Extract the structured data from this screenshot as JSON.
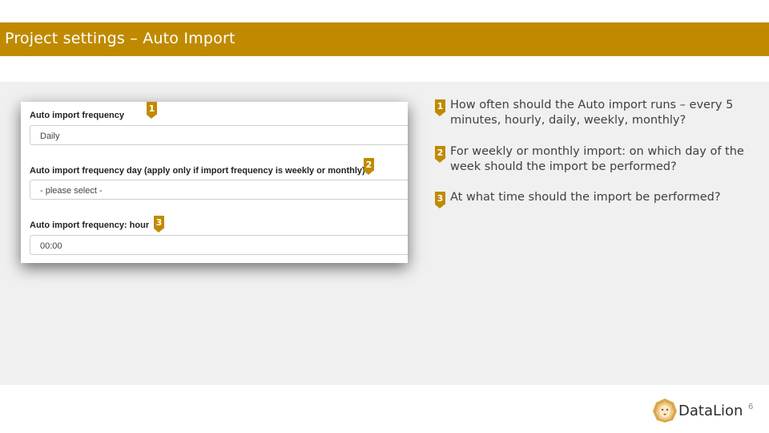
{
  "slide": {
    "title": "Project settings – Auto Import",
    "page_number": "6"
  },
  "form": {
    "fields": [
      {
        "label": "Auto import frequency",
        "value": "Daily",
        "marker": "1"
      },
      {
        "label": "Auto import frequency day (apply only if import frequency is weekly or monthly)",
        "value": "- please select -",
        "marker": "2"
      },
      {
        "label": "Auto import frequency: hour",
        "value": "00:00",
        "marker": "3"
      }
    ]
  },
  "notes": [
    {
      "marker": "1",
      "text": "How often should the Auto import runs – every 5 minutes, hourly, daily, weekly, monthly?"
    },
    {
      "marker": "2",
      "text": "For weekly or monthly import: on which day of the week should the import be performed?"
    },
    {
      "marker": "3",
      "text": "At what time should the import be performed?"
    }
  ],
  "logo": {
    "text": "DataLion",
    "icon": "lion-head-icon"
  },
  "colors": {
    "accent": "#c08a00",
    "content_background": "#f0f0f0",
    "text": "#404040"
  }
}
